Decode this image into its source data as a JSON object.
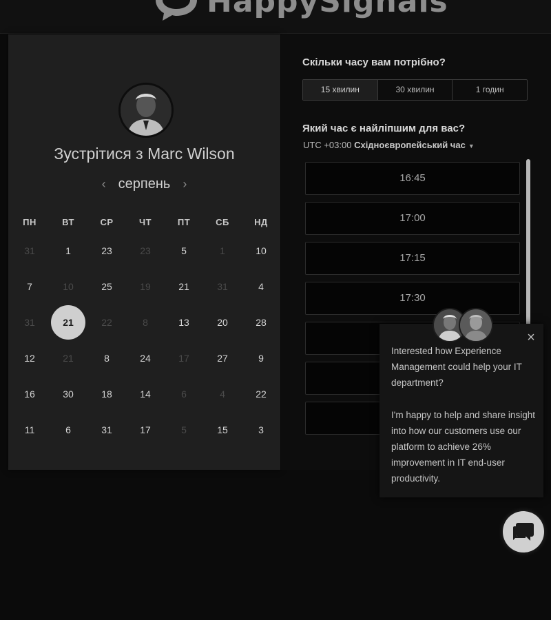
{
  "header": {
    "logo_text": "HappySignals"
  },
  "calendar": {
    "title": "Зустрітися з Marc Wilson",
    "month": "серпень",
    "prev_arrow": "‹",
    "next_arrow": "›",
    "weekdays": [
      "ПН",
      "ВТ",
      "СР",
      "ЧТ",
      "ПТ",
      "СБ",
      "НД"
    ],
    "weeks": [
      [
        {
          "d": "31",
          "m": true
        },
        {
          "d": "1",
          "m": false
        },
        {
          "d": "23",
          "m": false
        },
        {
          "d": "23",
          "m": true
        },
        {
          "d": "5",
          "m": false
        },
        {
          "d": "1",
          "m": true
        },
        {
          "d": "10",
          "m": false
        }
      ],
      [
        {
          "d": "7",
          "m": false
        },
        {
          "d": "10",
          "m": true
        },
        {
          "d": "25",
          "m": false
        },
        {
          "d": "19",
          "m": true
        },
        {
          "d": "21",
          "m": false
        },
        {
          "d": "31",
          "m": true
        },
        {
          "d": "4",
          "m": false
        }
      ],
      [
        {
          "d": "31",
          "m": true
        },
        {
          "d": "21",
          "m": false,
          "s": true
        },
        {
          "d": "22",
          "m": true
        },
        {
          "d": "8",
          "m": true
        },
        {
          "d": "13",
          "m": false
        },
        {
          "d": "20",
          "m": false
        },
        {
          "d": "28",
          "m": false
        }
      ],
      [
        {
          "d": "12",
          "m": false
        },
        {
          "d": "21",
          "m": true
        },
        {
          "d": "8",
          "m": false
        },
        {
          "d": "24",
          "m": false
        },
        {
          "d": "17",
          "m": true
        },
        {
          "d": "27",
          "m": false
        },
        {
          "d": "9",
          "m": false
        }
      ],
      [
        {
          "d": "16",
          "m": false
        },
        {
          "d": "30",
          "m": false
        },
        {
          "d": "18",
          "m": false
        },
        {
          "d": "14",
          "m": false
        },
        {
          "d": "6",
          "m": true
        },
        {
          "d": "4",
          "m": true
        },
        {
          "d": "22",
          "m": false
        }
      ],
      [
        {
          "d": "11",
          "m": false
        },
        {
          "d": "6",
          "m": false
        },
        {
          "d": "31",
          "m": false
        },
        {
          "d": "17",
          "m": false
        },
        {
          "d": "5",
          "m": true
        },
        {
          "d": "15",
          "m": false
        },
        {
          "d": "3",
          "m": false
        }
      ]
    ]
  },
  "scheduler": {
    "duration_question": "Скільки часу вам потрібно?",
    "durations": [
      {
        "label": "15 хвилин",
        "active": true
      },
      {
        "label": "30 хвилин",
        "active": false
      },
      {
        "label": "1 годин",
        "active": false
      }
    ],
    "time_question": "Який час є найліпшим для вас?",
    "tz_prefix": "UTC +03:00",
    "tz_name": "Східноєвропейський час",
    "tz_caret": "▼",
    "slots": [
      "16:45",
      "17:00",
      "17:15",
      "17:30",
      "",
      "",
      "",
      ""
    ]
  },
  "chat": {
    "close": "×",
    "message_1": "Interested how Experience Management could help your IT department?",
    "message_2": "I'm happy to help and share insight into how our customers use our platform to achieve 26% improvement in IT end-user productivity."
  },
  "colors": {
    "selected_day_bg": "#cfcfcf",
    "panel_bg": "#1f1f1f",
    "page_bg": "#0b0b0b"
  }
}
